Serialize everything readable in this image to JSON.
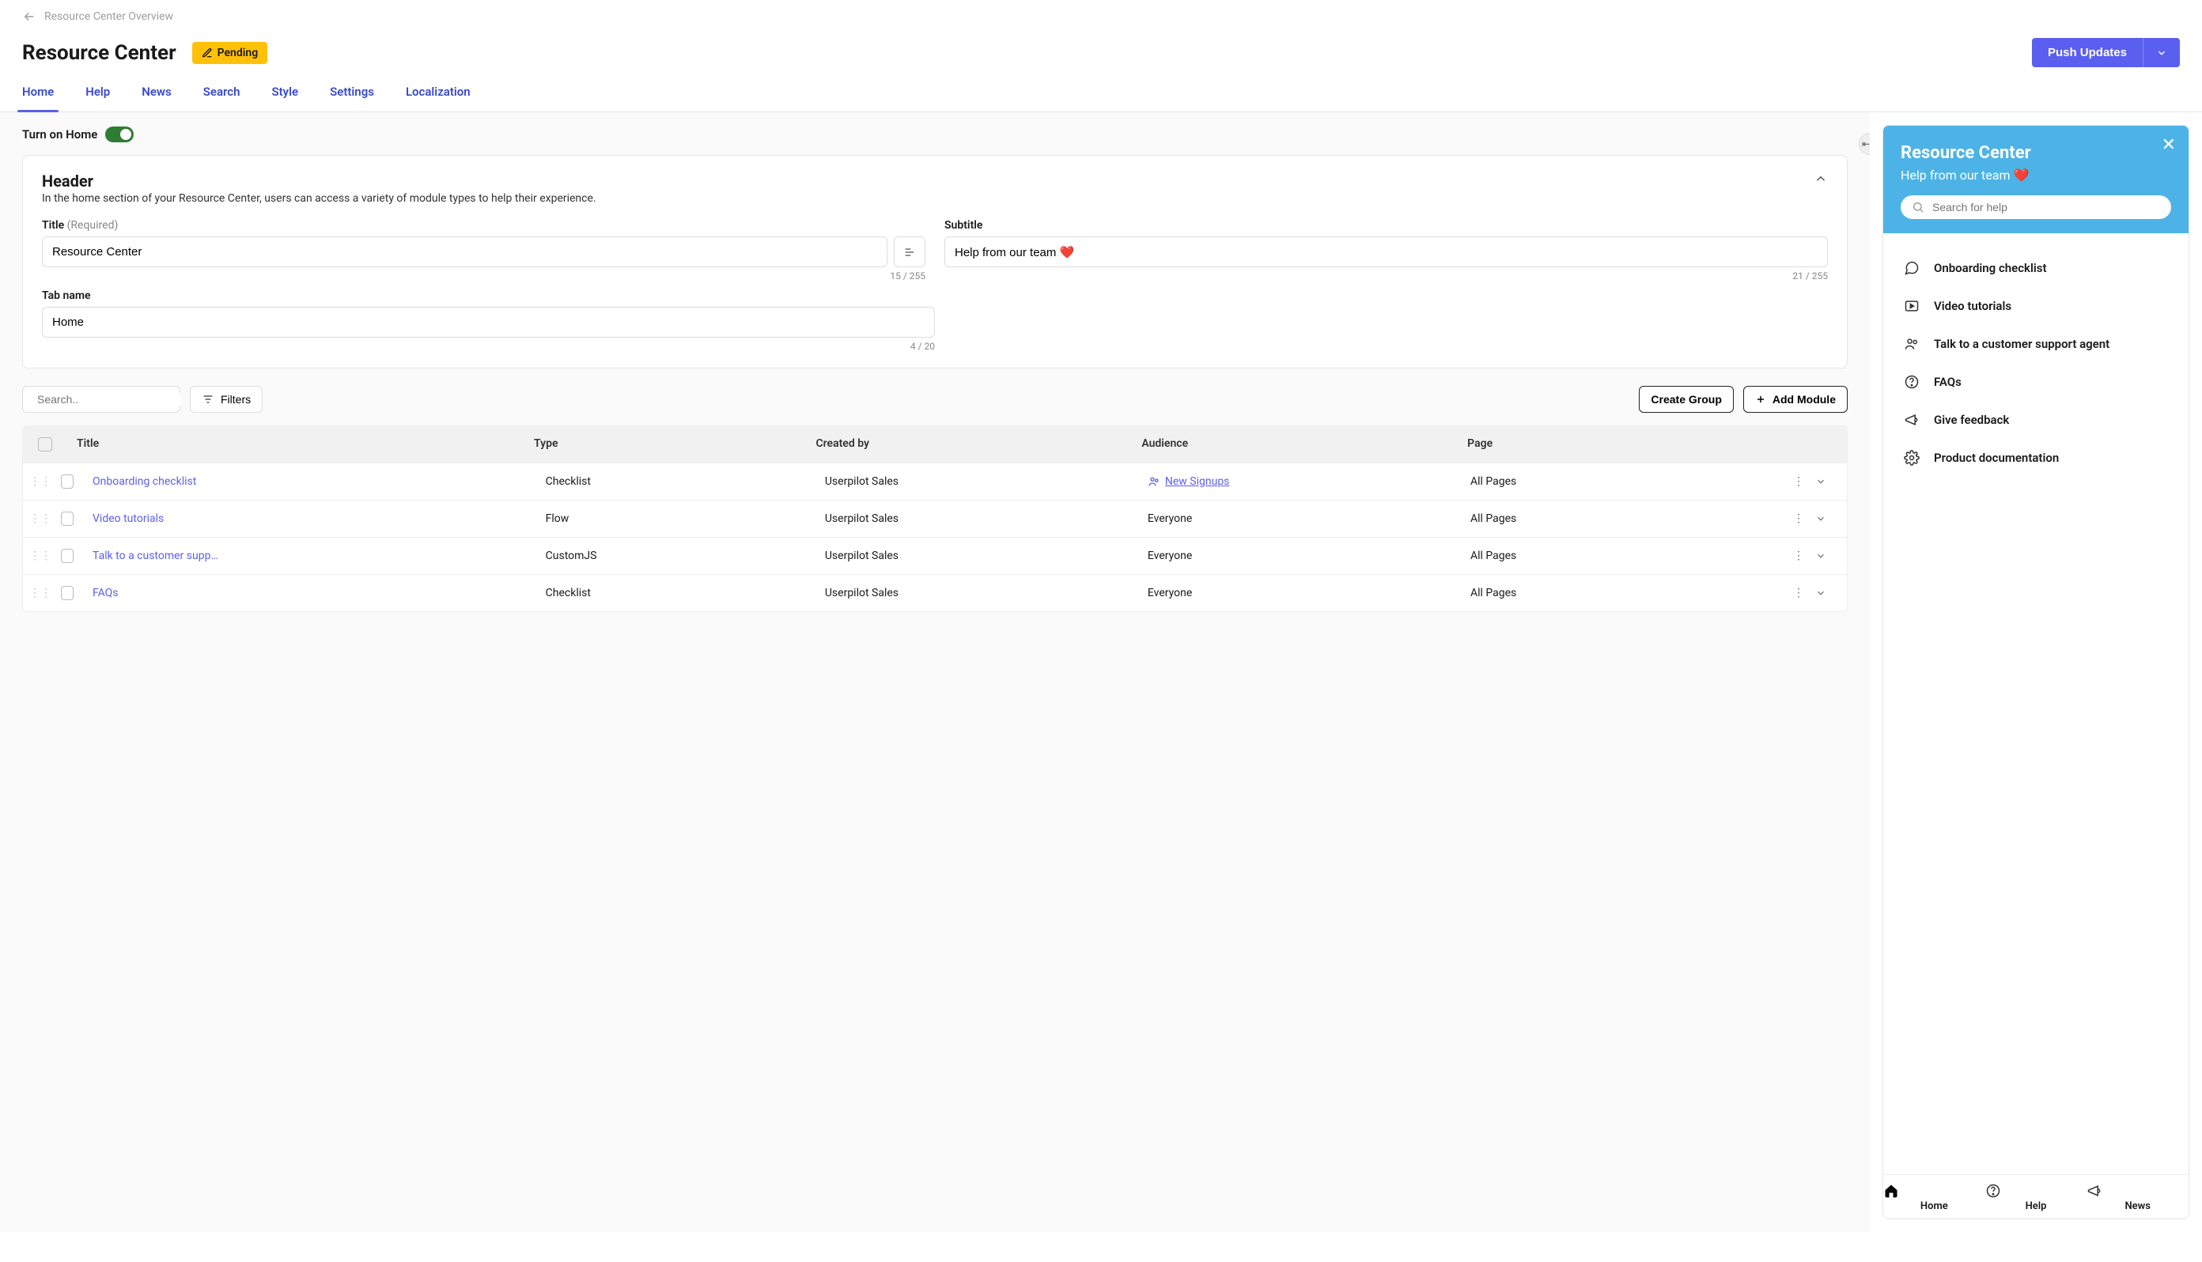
{
  "breadcrumb": {
    "back_label": "Resource Center Overview"
  },
  "page": {
    "title": "Resource Center",
    "status_label": "Pending",
    "push_btn": "Push Updates"
  },
  "tabs": [
    "Home",
    "Help",
    "News",
    "Search",
    "Style",
    "Settings",
    "Localization"
  ],
  "toggle_label": "Turn on Home",
  "header_card": {
    "title": "Header",
    "desc": "In the home section of your Resource Center, users can access a variety of module types to help their experience.",
    "fields": {
      "title_label": "Title",
      "title_required": "(Required)",
      "title_value": "Resource Center",
      "title_counter": "15 / 255",
      "subtitle_label": "Subtitle",
      "subtitle_value": "Help from our team ❤️",
      "subtitle_counter": "21 / 255",
      "tabname_label": "Tab name",
      "tabname_value": "Home",
      "tabname_counter": "4 / 20"
    }
  },
  "list_toolbar": {
    "search_placeholder": "Search..",
    "filters": "Filters",
    "create_group": "Create Group",
    "add_module": "Add Module"
  },
  "columns": {
    "title": "Title",
    "type": "Type",
    "by": "Created by",
    "aud": "Audience",
    "page": "Page"
  },
  "rows": [
    {
      "title": "Onboarding checklist",
      "type": "Checklist",
      "by": "Userpilot Sales",
      "aud": "New Signups",
      "aud_link": true,
      "page": "All Pages"
    },
    {
      "title": "Video tutorials",
      "type": "Flow",
      "by": "Userpilot Sales",
      "aud": "Everyone",
      "aud_link": false,
      "page": "All Pages"
    },
    {
      "title": "Talk to a customer supp…",
      "type": "CustomJS",
      "by": "Userpilot Sales",
      "aud": "Everyone",
      "aud_link": false,
      "page": "All Pages"
    },
    {
      "title": "FAQs",
      "type": "Checklist",
      "by": "Userpilot Sales",
      "aud": "Everyone",
      "aud_link": false,
      "page": "All Pages"
    }
  ],
  "preview": {
    "title": "Resource Center",
    "subtitle": "Help from our team ❤️",
    "search_placeholder": "Search for help",
    "items": [
      {
        "icon": "chat",
        "label": "Onboarding checklist"
      },
      {
        "icon": "video",
        "label": "Video tutorials"
      },
      {
        "icon": "people",
        "label": "Talk to a customer support agent"
      },
      {
        "icon": "help",
        "label": "FAQs"
      },
      {
        "icon": "megaphone",
        "label": "Give feedback"
      },
      {
        "icon": "gear",
        "label": "Product documentation"
      }
    ],
    "tabs": [
      {
        "icon": "home",
        "label": "Home"
      },
      {
        "icon": "help",
        "label": "Help"
      },
      {
        "icon": "megaphone",
        "label": "News"
      }
    ]
  }
}
